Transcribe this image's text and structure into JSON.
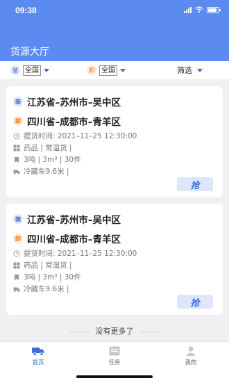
{
  "status_bar": {
    "time": "09:38"
  },
  "header": {
    "title": "货源大厅"
  },
  "filters": {
    "load_chip": "装",
    "load_value": "全国",
    "unload_chip": "卸",
    "unload_value": "全国",
    "filter_label": "筛选"
  },
  "cards": [
    {
      "load_chip": "装",
      "from": "江苏省–苏州市–吴中区",
      "unload_chip": "卸",
      "to": "四川省–成都市–青羊区",
      "pickup": "提货时间:   2021–11–25 12:30:00",
      "goods": "药品  |  常温货  |",
      "spec": "3吨  |  3m³  |  30件",
      "vehicle": "冷藏车9.6米  |",
      "grab_label": "抢"
    },
    {
      "load_chip": "装",
      "from": "江苏省–苏州市–吴中区",
      "unload_chip": "卸",
      "to": "四川省–成都市–青羊区",
      "pickup": "提货时间:   2021–11–25 12:30:00",
      "goods": "药品  |  常温货  |",
      "spec": "3吨  |  3m³  |  30件",
      "vehicle": "冷藏车9.6米  |",
      "grab_label": "抢"
    }
  ],
  "footer_text": "没有更多了",
  "bottom_nav": [
    {
      "label": "首页",
      "icon": "truck-icon",
      "active": true
    },
    {
      "label": "任务",
      "icon": "task-icon",
      "active": false
    },
    {
      "label": "我的",
      "icon": "user-icon",
      "active": false
    }
  ],
  "colors": {
    "primary": "#5b8bf0",
    "accent": "#3b6ed8",
    "unload": "#e07b22"
  }
}
